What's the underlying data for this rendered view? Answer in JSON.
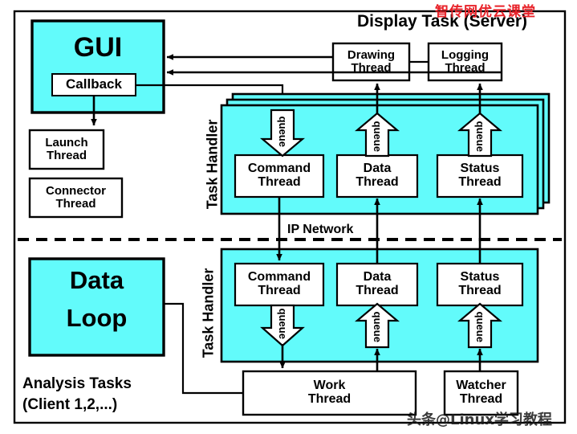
{
  "diagram": {
    "title": "Display Task (Server)",
    "colors": {
      "fill_cyan": "#62FBFB",
      "fill_white": "#FFFFFF",
      "stroke": "#000000",
      "watermark_top": "#E8232A",
      "watermark_bottom": "#1A1A1A"
    },
    "watermarks": {
      "top_right": "智传网优云课堂",
      "bottom_right": "头条@Linux学习教程"
    },
    "network_label": "IP Network",
    "server": {
      "section_title": "Display Task (Server)",
      "gui_box": "GUI",
      "callback_box": "Callback",
      "launch_thread": "Launch\nThread",
      "connector_thread": "Connector\nThread",
      "drawing_thread": "Drawing\nThread",
      "logging_thread": "Logging\nThread",
      "task_handler_label": "Task Handler",
      "threads": [
        {
          "name": "Command\nThread",
          "queue": "queue",
          "direction": "down"
        },
        {
          "name": "Data\nThread",
          "queue": "queue",
          "direction": "up"
        },
        {
          "name": "Status\nThread",
          "queue": "queue",
          "direction": "up"
        }
      ]
    },
    "client": {
      "section_title": "Analysis Tasks\n(Client 1,2,...)",
      "analysis_line1": "Analysis Tasks",
      "analysis_line2": "(Client 1,2,...)",
      "data_loop_line1": "Data",
      "data_loop_line2": "Loop",
      "task_handler_label": "Task Handler",
      "threads": [
        {
          "name": "Command\nThread",
          "queue": "queue",
          "direction": "down"
        },
        {
          "name": "Data\nThread",
          "queue": "queue",
          "direction": "up"
        },
        {
          "name": "Status\nThread",
          "queue": "queue",
          "direction": "up"
        }
      ],
      "work_thread": "Work\nThread",
      "watcher_thread": "Watcher\nThread"
    },
    "labels": {
      "command_thread": "Command",
      "data_thread": "Data",
      "status_thread": "Status",
      "thread_word": "Thread",
      "queue_word": "queue"
    }
  }
}
